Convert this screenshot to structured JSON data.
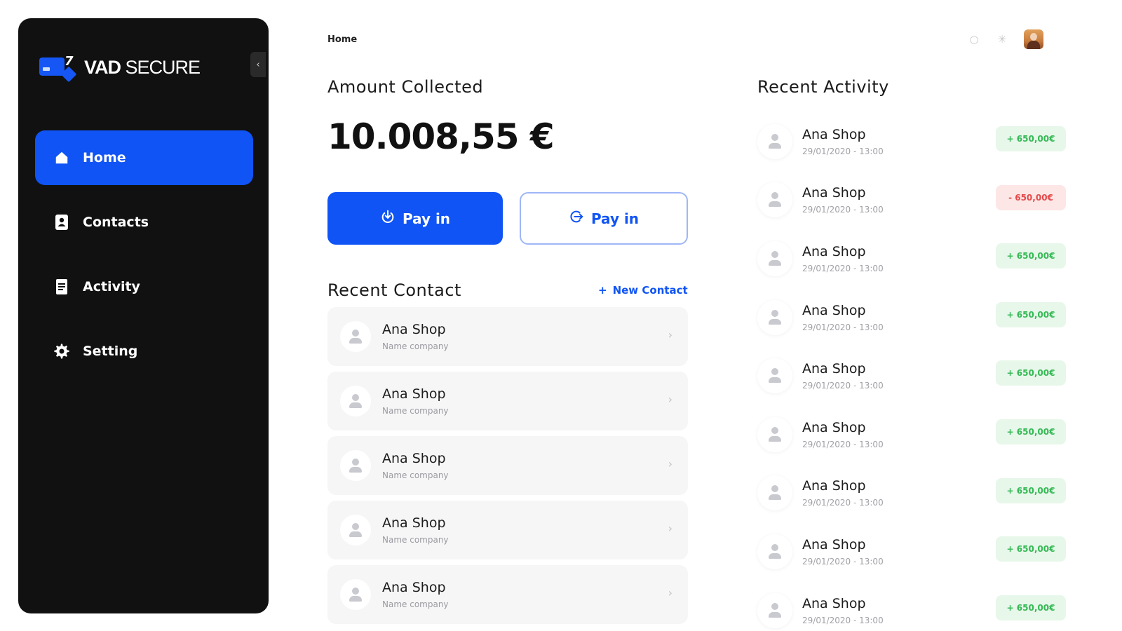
{
  "app": {
    "logo_strong": "VAD",
    "logo_light": "SECURE"
  },
  "sidebar": {
    "items": [
      {
        "label": "Home",
        "icon": "home-icon",
        "active": true
      },
      {
        "label": "Contacts",
        "icon": "contacts-icon",
        "active": false
      },
      {
        "label": "Activity",
        "icon": "activity-icon",
        "active": false
      },
      {
        "label": "Setting",
        "icon": "gear-icon",
        "active": false
      }
    ]
  },
  "header": {
    "breadcrumb": "Home"
  },
  "amount": {
    "title": "Amount Collected",
    "value": "10.008,55 €"
  },
  "actions": {
    "pay_in_primary": "Pay in",
    "pay_in_secondary": "Pay in"
  },
  "recent_contact": {
    "title": "Recent Contact",
    "new_contact_label": "New Contact",
    "items": [
      {
        "name": "Ana Shop",
        "company": "Name company"
      },
      {
        "name": "Ana Shop",
        "company": "Name company"
      },
      {
        "name": "Ana Shop",
        "company": "Name company"
      },
      {
        "name": "Ana Shop",
        "company": "Name company"
      },
      {
        "name": "Ana Shop",
        "company": "Name company"
      }
    ]
  },
  "recent_activity": {
    "title": "Recent Activity",
    "items": [
      {
        "name": "Ana Shop",
        "datetime": "29/01/2020 - 13:00",
        "amount": "+ 650,00€",
        "kind": "pos"
      },
      {
        "name": "Ana Shop",
        "datetime": "29/01/2020 - 13:00",
        "amount": "- 650,00€",
        "kind": "neg"
      },
      {
        "name": "Ana Shop",
        "datetime": "29/01/2020 - 13:00",
        "amount": "+ 650,00€",
        "kind": "pos"
      },
      {
        "name": "Ana Shop",
        "datetime": "29/01/2020 - 13:00",
        "amount": "+ 650,00€",
        "kind": "pos"
      },
      {
        "name": "Ana Shop",
        "datetime": "29/01/2020 - 13:00",
        "amount": "+ 650,00€",
        "kind": "pos"
      },
      {
        "name": "Ana Shop",
        "datetime": "29/01/2020 - 13:00",
        "amount": "+ 650,00€",
        "kind": "pos"
      },
      {
        "name": "Ana Shop",
        "datetime": "29/01/2020 - 13:00",
        "amount": "+ 650,00€",
        "kind": "pos"
      },
      {
        "name": "Ana Shop",
        "datetime": "29/01/2020 - 13:00",
        "amount": "+ 650,00€",
        "kind": "pos"
      },
      {
        "name": "Ana Shop",
        "datetime": "29/01/2020 - 13:00",
        "amount": "+ 650,00€",
        "kind": "pos"
      }
    ]
  },
  "colors": {
    "accent": "#1054f5",
    "sidebar_bg": "#111111",
    "positive": "#35b955",
    "negative": "#e44a4a"
  }
}
